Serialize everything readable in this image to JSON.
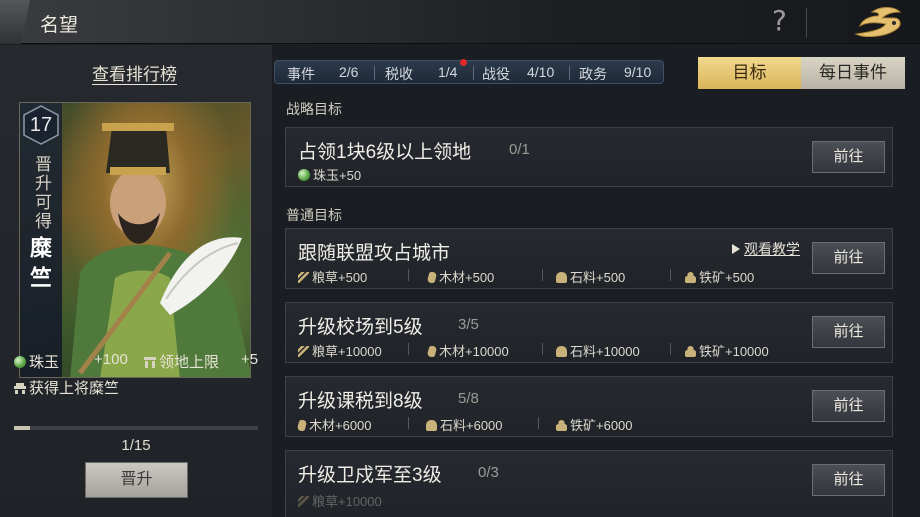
{
  "header": {
    "title": "名望"
  },
  "left": {
    "rank_link": "查看排行榜",
    "level": "17",
    "promote_hint": "晋升可得",
    "general_name": "糜竺",
    "rewards": [
      {
        "icon": "gem-icon",
        "label": "珠玉",
        "value": "+100"
      },
      {
        "icon": "territory-icon",
        "label": "领地上限",
        "value": "+5"
      }
    ],
    "unlock_text": "获得上将糜竺",
    "progress": {
      "current": 1,
      "total": 15,
      "text": "1/15",
      "fraction": 0.0667
    },
    "promote_button": "晋升"
  },
  "stats": [
    {
      "label": "事件",
      "value": "2/6"
    },
    {
      "label": "税收",
      "value": "1/4",
      "alert": true
    },
    {
      "label": "战役",
      "value": "4/10"
    },
    {
      "label": "政务",
      "value": "9/10"
    }
  ],
  "tabs": [
    {
      "label": "目标",
      "active": true
    },
    {
      "label": "每日事件",
      "active": false
    }
  ],
  "sections": {
    "strategic": "战略目标",
    "normal": "普通目标"
  },
  "goto_label": "前往",
  "tutorial_label": "观看教学",
  "goals": [
    {
      "title": "占领1块6级以上领地",
      "progress": "0/1",
      "rewards": [
        {
          "icon": "gem-icon",
          "text": "珠玉+50"
        }
      ]
    },
    {
      "title": "跟随联盟攻占城市",
      "progress": "",
      "rewards": [
        {
          "icon": "grain-icon",
          "text": "粮草+500"
        },
        {
          "icon": "wood-icon",
          "text": "木材+500"
        },
        {
          "icon": "stone-icon",
          "text": "石料+500"
        },
        {
          "icon": "iron-icon",
          "text": "铁矿+500"
        }
      ]
    },
    {
      "title": "升级校场到5级",
      "progress": "3/5",
      "rewards": [
        {
          "icon": "grain-icon",
          "text": "粮草+10000"
        },
        {
          "icon": "wood-icon",
          "text": "木材+10000"
        },
        {
          "icon": "stone-icon",
          "text": "石料+10000"
        },
        {
          "icon": "iron-icon",
          "text": "铁矿+10000"
        }
      ]
    },
    {
      "title": "升级课税到8级",
      "progress": "5/8",
      "rewards": [
        {
          "icon": "wood-icon",
          "text": "木材+6000"
        },
        {
          "icon": "stone-icon",
          "text": "石料+6000"
        },
        {
          "icon": "iron-icon",
          "text": "铁矿+6000"
        }
      ]
    },
    {
      "title": "升级卫戍军至3级",
      "progress": "0/3",
      "rewards": [
        {
          "icon": "grain-icon",
          "text": "粮草+10000"
        }
      ]
    }
  ],
  "colors": {
    "tab_active": "#e8c66f",
    "alert_dot": "#e02a2a",
    "stats_bar": "#26334a"
  }
}
